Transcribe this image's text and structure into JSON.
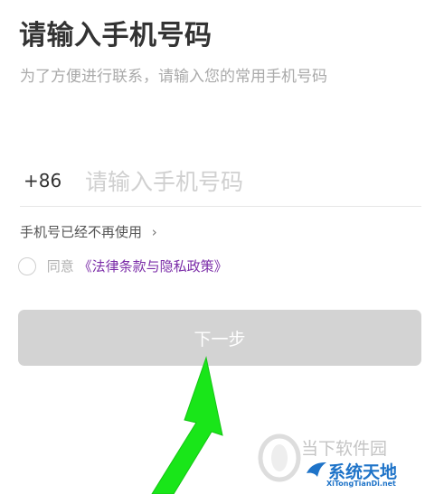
{
  "login": {
    "title": "请输入手机号码",
    "subtitle": "为了方便进行联系，请输入您的常用手机号码",
    "country_code": "+86",
    "phone_placeholder": "请输入手机号码",
    "phone_value": "",
    "no_longer_use_label": "手机号已经不再使用",
    "no_longer_use_chevron": "›",
    "agree_prefix": "同意",
    "policy_link": "《法律条款与隐私政策》",
    "agreed": false,
    "next_button_label": "下一步"
  },
  "watermark": {
    "site_name_cn": "当下软件园",
    "brand_cn": "系统天地",
    "brand_url": "XiTongTianDi.net"
  },
  "colors": {
    "title_text": "#333333",
    "hint_text": "#aaaaaa",
    "policy_link": "#7b2da8",
    "button_disabled": "#d3d3d3",
    "arrow": "#19e619",
    "brand_blue": "#1e73c8"
  },
  "icons": {
    "chevron": "chevron-right-icon",
    "radio": "radio-unchecked-icon",
    "annotation": "green-arrow-icon",
    "watermark_logo": "watermark-logo-icon"
  }
}
